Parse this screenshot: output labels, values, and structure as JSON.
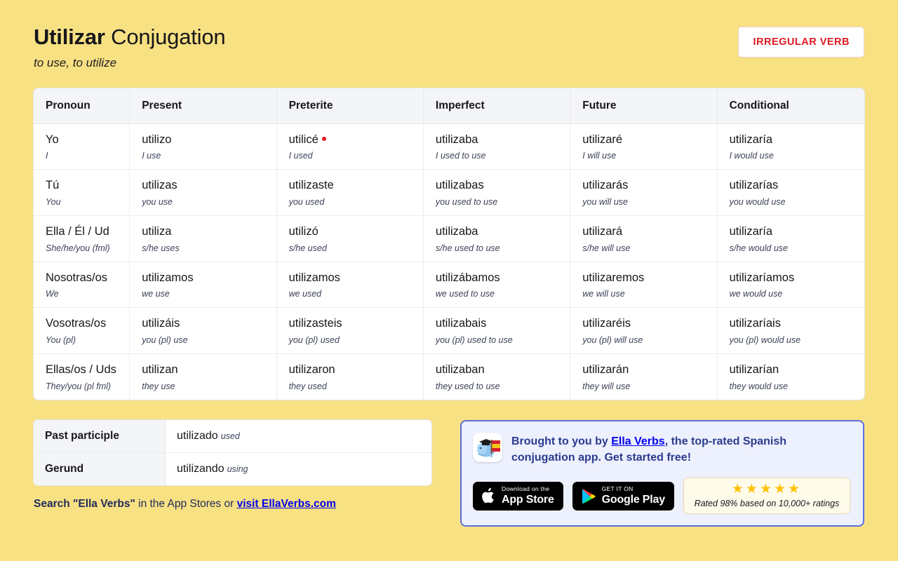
{
  "header": {
    "verb": "Utilizar",
    "title_suffix": " Conjugation",
    "subtitle": "to use, to utilize",
    "badge": "IRREGULAR VERB"
  },
  "table": {
    "columns": [
      "Pronoun",
      "Present",
      "Preterite",
      "Imperfect",
      "Future",
      "Conditional"
    ],
    "rows": [
      {
        "pronoun": "Yo",
        "pronoun_translation": "I",
        "present": "utilizo",
        "present_translation": "I use",
        "preterite": "utilicé",
        "preterite_translation": "I used",
        "preterite_irregular": true,
        "imperfect": "utilizaba",
        "imperfect_translation": "I used to use",
        "future": "utilizaré",
        "future_translation": "I will use",
        "conditional": "utilizaría",
        "conditional_translation": "I would use"
      },
      {
        "pronoun": "Tú",
        "pronoun_translation": "You",
        "present": "utilizas",
        "present_translation": "you use",
        "preterite": "utilizaste",
        "preterite_translation": "you used",
        "preterite_irregular": false,
        "imperfect": "utilizabas",
        "imperfect_translation": "you used to use",
        "future": "utilizarás",
        "future_translation": "you will use",
        "conditional": "utilizarías",
        "conditional_translation": "you would use"
      },
      {
        "pronoun": "Ella / Él / Ud",
        "pronoun_translation": "She/he/you (fml)",
        "present": "utiliza",
        "present_translation": "s/he uses",
        "preterite": "utilizó",
        "preterite_translation": "s/he used",
        "preterite_irregular": false,
        "imperfect": "utilizaba",
        "imperfect_translation": "s/he used to use",
        "future": "utilizará",
        "future_translation": "s/he will use",
        "conditional": "utilizaría",
        "conditional_translation": "s/he would use"
      },
      {
        "pronoun": "Nosotras/os",
        "pronoun_translation": "We",
        "present": "utilizamos",
        "present_translation": "we use",
        "preterite": "utilizamos",
        "preterite_translation": "we used",
        "preterite_irregular": false,
        "imperfect": "utilizábamos",
        "imperfect_translation": "we used to use",
        "future": "utilizaremos",
        "future_translation": "we will use",
        "conditional": "utilizaríamos",
        "conditional_translation": "we would use"
      },
      {
        "pronoun": "Vosotras/os",
        "pronoun_translation": "You (pl)",
        "present": "utilizáis",
        "present_translation": "you (pl) use",
        "preterite": "utilizasteis",
        "preterite_translation": "you (pl) used",
        "preterite_irregular": false,
        "imperfect": "utilizabais",
        "imperfect_translation": "you (pl) used to use",
        "future": "utilizaréis",
        "future_translation": "you (pl) will use",
        "conditional": "utilizaríais",
        "conditional_translation": "you (pl) would use"
      },
      {
        "pronoun": "Ellas/os / Uds",
        "pronoun_translation": "They/you (pl fml)",
        "present": "utilizan",
        "present_translation": "they use",
        "preterite": "utilizaron",
        "preterite_translation": "they used",
        "preterite_irregular": false,
        "imperfect": "utilizaban",
        "imperfect_translation": "they used to use",
        "future": "utilizarán",
        "future_translation": "they will use",
        "conditional": "utilizarían",
        "conditional_translation": "they would use"
      }
    ]
  },
  "extra": {
    "past_participle_label": "Past participle",
    "past_participle_value": "utilizado",
    "past_participle_translation": "used",
    "gerund_label": "Gerund",
    "gerund_value": "utilizando",
    "gerund_translation": "using"
  },
  "search_line": {
    "part1": "Search \"Ella Verbs\"",
    "part2": " in the App Stores or ",
    "link": "visit EllaVerbs.com"
  },
  "promo": {
    "text_before": "Brought to you by ",
    "link": "Ella Verbs",
    "text_after": ", the top-rated Spanish conjugation app. Get started free!",
    "app_store_small": "Download on the",
    "app_store_big": "App Store",
    "google_play_small": "GET IT ON",
    "google_play_big": "Google Play",
    "stars": "★★★★★",
    "rating_text": "Rated 98% based on 10,000+ ratings"
  },
  "colors": {
    "background": "#F8E183",
    "accent_red": "#E01B24",
    "promo_border": "#5B6EE0",
    "promo_bg": "#EDF0FD",
    "star_gold": "#FFC107",
    "navy_text": "#1F2A5B"
  }
}
